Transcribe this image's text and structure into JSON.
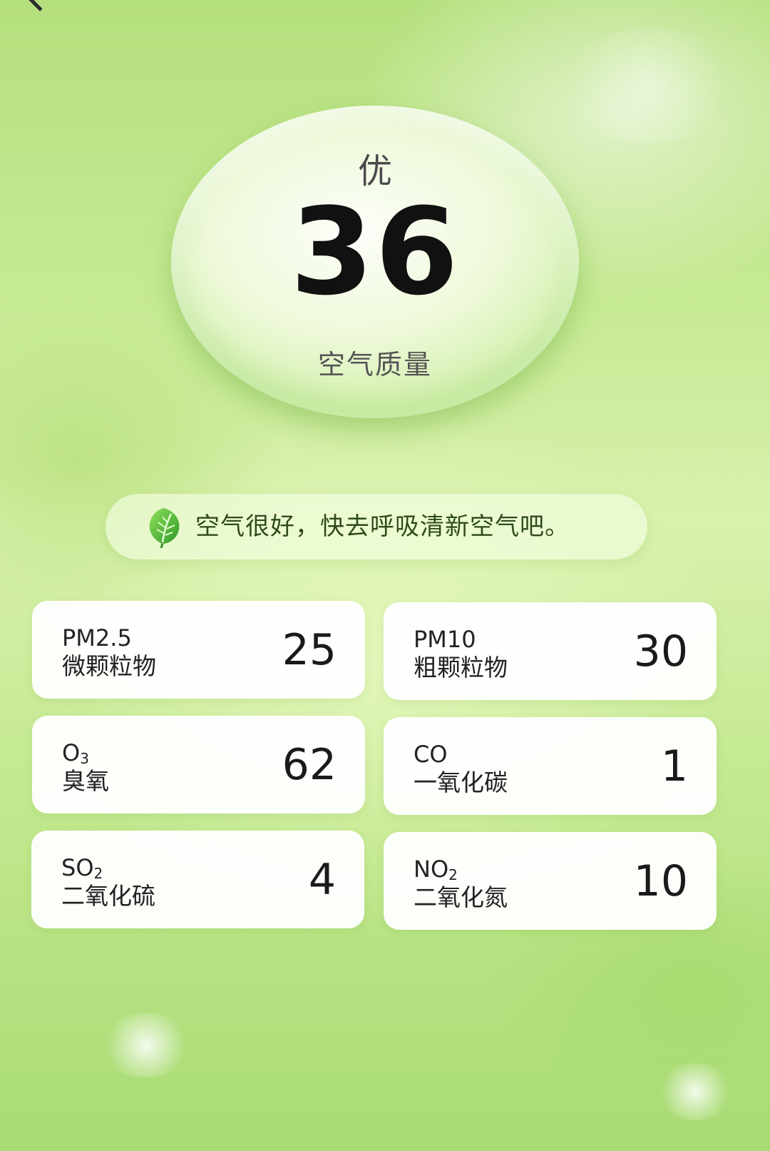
{
  "header": {
    "title": "",
    "back_icon": "chevron-left-icon"
  },
  "aqi": {
    "level": "优",
    "value": "36",
    "caption": "空气质量"
  },
  "tip": {
    "icon": "leaf-icon",
    "text": "空气很好，快去呼吸清新空气吧。"
  },
  "pollutants": [
    {
      "code": "PM2.5",
      "sub": "",
      "name": "微颗粒物",
      "value": "25"
    },
    {
      "code": "PM10",
      "sub": "",
      "name": "粗颗粒物",
      "value": "30"
    },
    {
      "code": "O",
      "sub": "3",
      "name": "臭氧",
      "value": "62"
    },
    {
      "code": "CO",
      "sub": "",
      "name": "一氧化碳",
      "value": "1"
    },
    {
      "code": "SO",
      "sub": "2",
      "name": "二氧化硫",
      "value": "4"
    },
    {
      "code": "NO",
      "sub": "2",
      "name": "二氧化氮",
      "value": "10"
    }
  ],
  "colors": {
    "background": "#c8ea96",
    "card": "#ffffff",
    "leaf": "#5fbf3a"
  }
}
